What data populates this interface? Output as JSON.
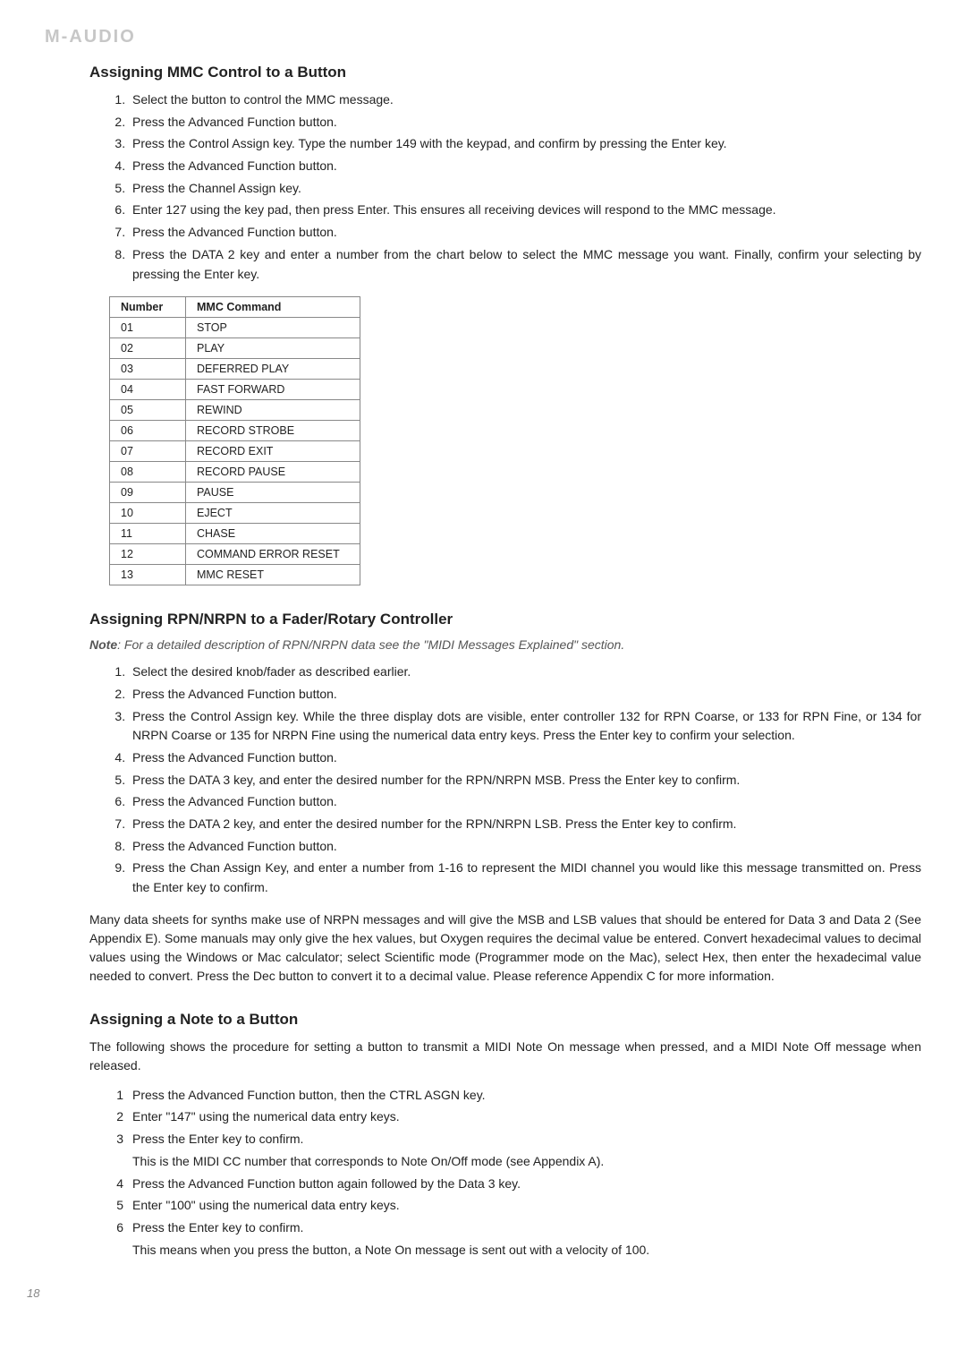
{
  "brand": "M-AUDIO",
  "page_number": "18",
  "section1": {
    "title": "Assigning MMC Control to a Button",
    "steps": [
      "Select the button to control the MMC message.",
      "Press the Advanced Function button.",
      "Press the Control Assign key. Type the number 149 with the keypad, and confirm by pressing the Enter key.",
      "Press the Advanced Function button.",
      "Press the Channel Assign key.",
      "Enter 127 using the key pad, then press Enter.  This ensures all receiving devices will respond to the MMC message.",
      "Press the Advanced Function button.",
      "Press the DATA 2 key and enter a number from the chart below to select the MMC message you want.  Finally, confirm your selecting by pressing the Enter key."
    ],
    "table": {
      "head_number": "Number",
      "head_command": "MMC Command",
      "rows": [
        {
          "n": "01",
          "c": "STOP"
        },
        {
          "n": "02",
          "c": "PLAY"
        },
        {
          "n": "03",
          "c": "DEFERRED PLAY"
        },
        {
          "n": "04",
          "c": "FAST FORWARD"
        },
        {
          "n": "05",
          "c": "REWIND"
        },
        {
          "n": "06",
          "c": "RECORD STROBE"
        },
        {
          "n": "07",
          "c": "RECORD EXIT"
        },
        {
          "n": "08",
          "c": "RECORD PAUSE"
        },
        {
          "n": "09",
          "c": "PAUSE"
        },
        {
          "n": "10",
          "c": "EJECT"
        },
        {
          "n": "11",
          "c": "CHASE"
        },
        {
          "n": "12",
          "c": "COMMAND ERROR RESET"
        },
        {
          "n": "13",
          "c": "MMC RESET"
        }
      ]
    }
  },
  "section2": {
    "title": "Assigning RPN/NRPN to a Fader/Rotary Controller",
    "note_label": "Note",
    "note_text": ": For a detailed description of RPN/NRPN data see the \"MIDI Messages Explained\" section.",
    "steps": [
      "Select the desired knob/fader as described earlier.",
      "Press the Advanced Function button.",
      "Press the Control Assign key. While the three display dots are visible, enter controller 132 for RPN Coarse, or 133 for RPN Fine, or 134 for NRPN Coarse or 135 for NRPN Fine using the numerical data entry keys.  Press the Enter key to confirm your selection.",
      "Press the Advanced Function button.",
      "Press the DATA 3 key, and enter the desired number for the RPN/NRPN MSB. Press the Enter key to confirm.",
      "Press the Advanced Function button.",
      "Press the DATA 2 key, and enter the desired number for the RPN/NRPN LSB. Press the Enter key to confirm.",
      "Press the Advanced Function button.",
      "Press the Chan Assign Key, and enter a number from 1-16 to represent the MIDI channel you would like this message transmitted on.  Press the Enter key to confirm."
    ],
    "body": "Many data sheets for synths make use of NRPN messages and will give the MSB and LSB values that should be entered for Data 3 and Data 2 (See Appendix E). Some manuals may only give the hex values, but Oxygen requires the decimal value be entered. Convert hexadecimal values to decimal values using the Windows or Mac calculator; select Scientific mode (Programmer mode on the Mac), select Hex, then enter the hexadecimal value needed to convert. Press the Dec button to convert it to a decimal value. Please reference Appendix C for more information."
  },
  "section3": {
    "title": "Assigning a Note to a Button",
    "intro": "The following shows the procedure for setting a button to transmit a MIDI Note On message when pressed, and a MIDI Note Off message when released.",
    "steps": [
      {
        "t": "Press the Advanced Function button, then the CTRL ASGN key."
      },
      {
        "t": "Enter \"147\" using the numerical data entry keys."
      },
      {
        "t": "Press the Enter key to confirm.",
        "sub": "This is the MIDI CC number that corresponds to Note On/Off mode (see Appendix A)."
      },
      {
        "t": "Press the Advanced Function button again followed by the Data 3 key."
      },
      {
        "t": "Enter \"100\" using the numerical data entry keys."
      },
      {
        "t": "Press the Enter key to confirm.",
        "sub": "This means when you press the button, a Note On message is sent out with a velocity of 100."
      }
    ]
  }
}
